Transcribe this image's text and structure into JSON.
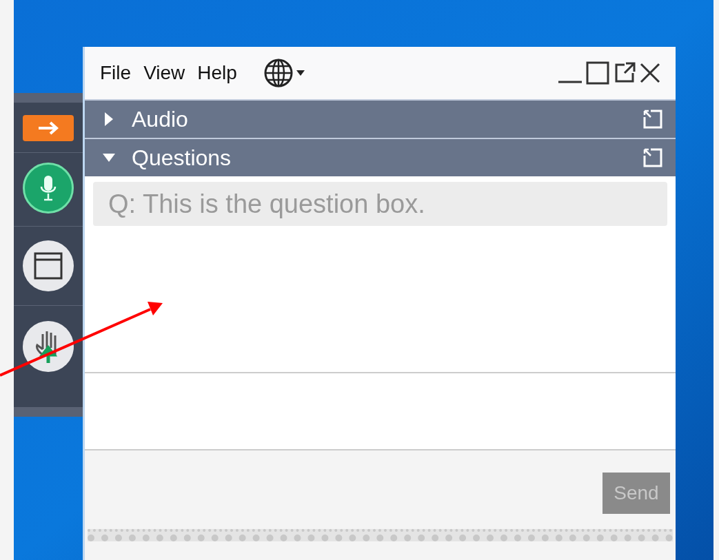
{
  "menu": [
    "File",
    "View",
    "Help"
  ],
  "panels": [
    {
      "title": "Audio",
      "expanded": false
    },
    {
      "title": "Questions",
      "expanded": true
    }
  ],
  "question": {
    "placeholder": "Q: This is the question box."
  },
  "send_button": {
    "label": "Send",
    "disabled": true
  }
}
